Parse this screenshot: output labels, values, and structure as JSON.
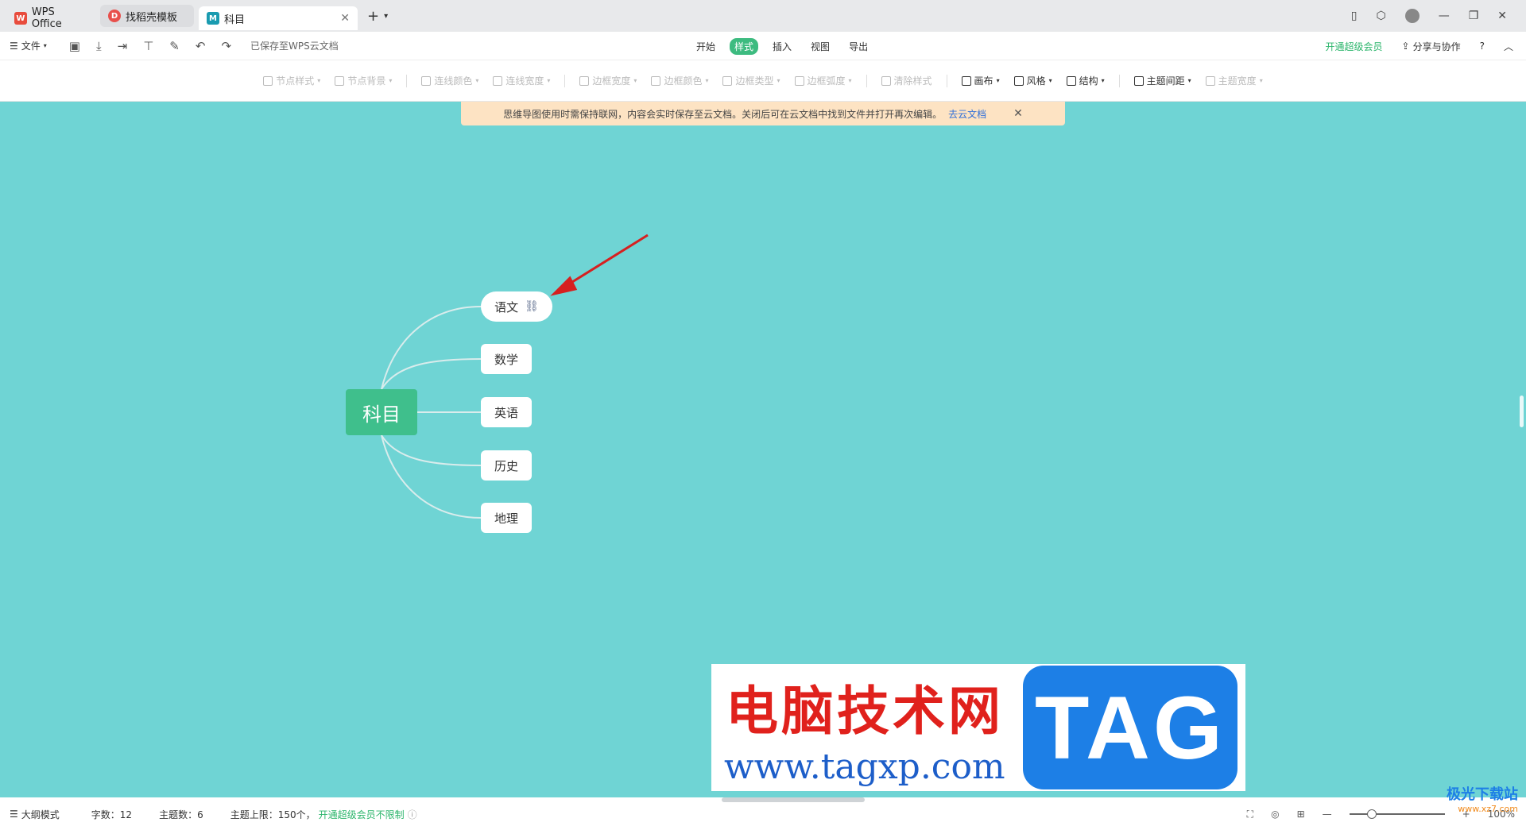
{
  "tabs": [
    {
      "label": "WPS Office"
    },
    {
      "label": "找稻壳模板"
    },
    {
      "label": "科目"
    }
  ],
  "menubar": {
    "file": "文件",
    "saved_status": "已保存至WPS云文档",
    "menus": [
      "开始",
      "样式",
      "插入",
      "视图",
      "导出"
    ],
    "active_menu": "样式",
    "vip": "开通超级会员",
    "share": "分享与协作",
    "help": "?"
  },
  "toolbar": {
    "items": [
      "节点样式",
      "节点背景",
      "连线颜色",
      "连线宽度",
      "边框宽度",
      "边框颜色",
      "边框类型",
      "边框弧度",
      "清除样式",
      "画布",
      "风格",
      "结构",
      "主题间距",
      "主题宽度"
    ]
  },
  "notice": {
    "text": "思维导图使用时需保持联网，内容会实时保存至云文档。关闭后可在云文档中找到文件并打开再次编辑。",
    "link": "去云文档"
  },
  "mindmap": {
    "root": "科目",
    "children": [
      "语文",
      "数学",
      "英语",
      "历史",
      "地理"
    ]
  },
  "watermark": {
    "cn": "电脑技术网",
    "url": "www.tagxp.com",
    "tag": "TAG",
    "brand": "极光下载站",
    "brand_url": "www.xz7.com"
  },
  "statusbar": {
    "outline": "大纲模式",
    "chars": "字数：12",
    "topics": "主题数：6",
    "limit": "主题上限：150个，",
    "limit_link": "开通超级会员不限制",
    "zoom": "100%"
  },
  "colors": {
    "canvas": "#6fd4d4",
    "root": "#3fbf8c",
    "accent": "#2bb56b",
    "arrow": "#d62020"
  }
}
